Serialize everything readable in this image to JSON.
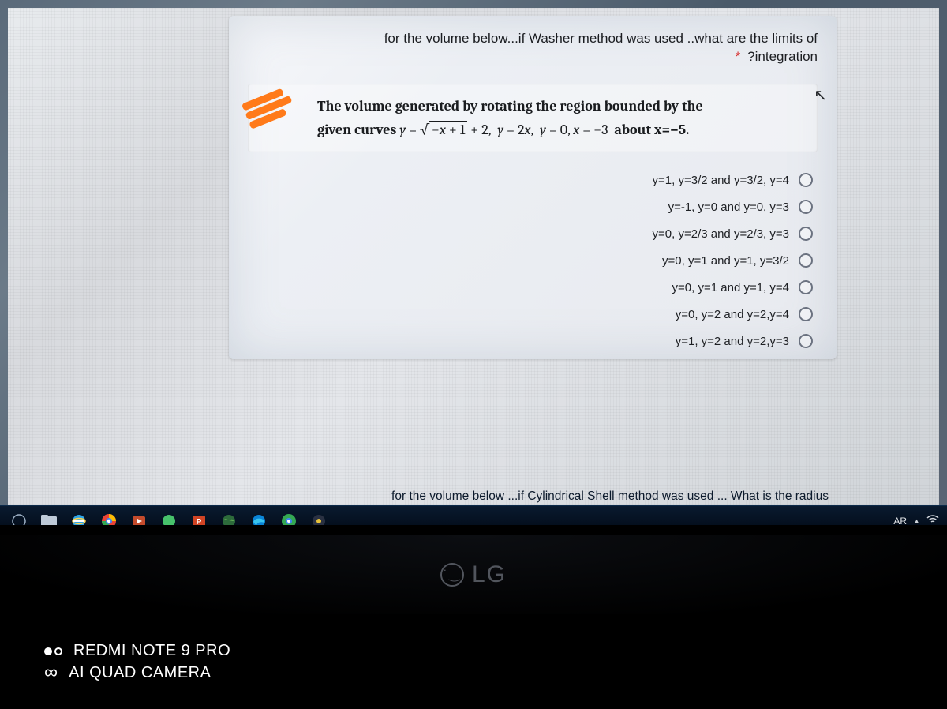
{
  "question": {
    "header_line1": "for the volume below...if Washer method was used ..what are the limits of",
    "header_line2": "?integration",
    "required_mark": "*",
    "problem_line1_prefix": "The volume generated by rotating the region bounded by the",
    "problem_line2_prefix": "given curves ",
    "problem_equation": "y = √(−x + 1) + 2,  y = 2x,  y = 0, x = −3  about x=−5.",
    "options": [
      "y=1, y=3/2 and y=3/2, y=4",
      "y=-1, y=0 and y=0, y=3",
      "y=0, y=2/3 and y=2/3, y=3",
      "y=0, y=1 and y=1, y=3/2",
      "y=0, y=1 and y=1, y=4",
      "y=0, y=2 and y=2,y=4",
      "y=1, y=2 and y=2,y=3"
    ]
  },
  "next_question": "for the volume below ...if Cylindrical Shell method was used ... What is the radius",
  "taskbar": {
    "lang": "AR"
  },
  "monitor": {
    "brand": "LG"
  },
  "watermark": {
    "line1": "REDMI NOTE 9 PRO",
    "line2": "AI QUAD CAMERA"
  }
}
